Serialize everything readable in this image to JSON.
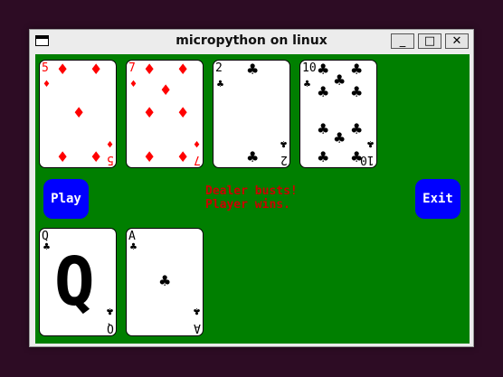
{
  "window": {
    "title": "micropython on linux",
    "minimize_label": "_",
    "maximize_label": "□",
    "close_label": "✕"
  },
  "controls": {
    "play_label": "Play",
    "exit_label": "Exit"
  },
  "status": {
    "line1": "Dealer busts!",
    "line2": "Player wins."
  },
  "dealer_hand": [
    {
      "rank": "5",
      "suit": "diamonds",
      "symbol": "♦",
      "color": "#ff0000"
    },
    {
      "rank": "7",
      "suit": "diamonds",
      "symbol": "♦",
      "color": "#ff0000"
    },
    {
      "rank": "2",
      "suit": "clubs",
      "symbol": "♣",
      "color": "#000000"
    },
    {
      "rank": "10",
      "suit": "clubs",
      "symbol": "♣",
      "color": "#000000"
    }
  ],
  "player_hand": [
    {
      "rank": "Q",
      "suit": "clubs",
      "symbol": "♣",
      "color": "#000000"
    },
    {
      "rank": "A",
      "suit": "clubs",
      "symbol": "♣",
      "color": "#000000"
    }
  ],
  "colors": {
    "table": "#007f00",
    "button": "#0000ff",
    "message": "#cc0000"
  }
}
